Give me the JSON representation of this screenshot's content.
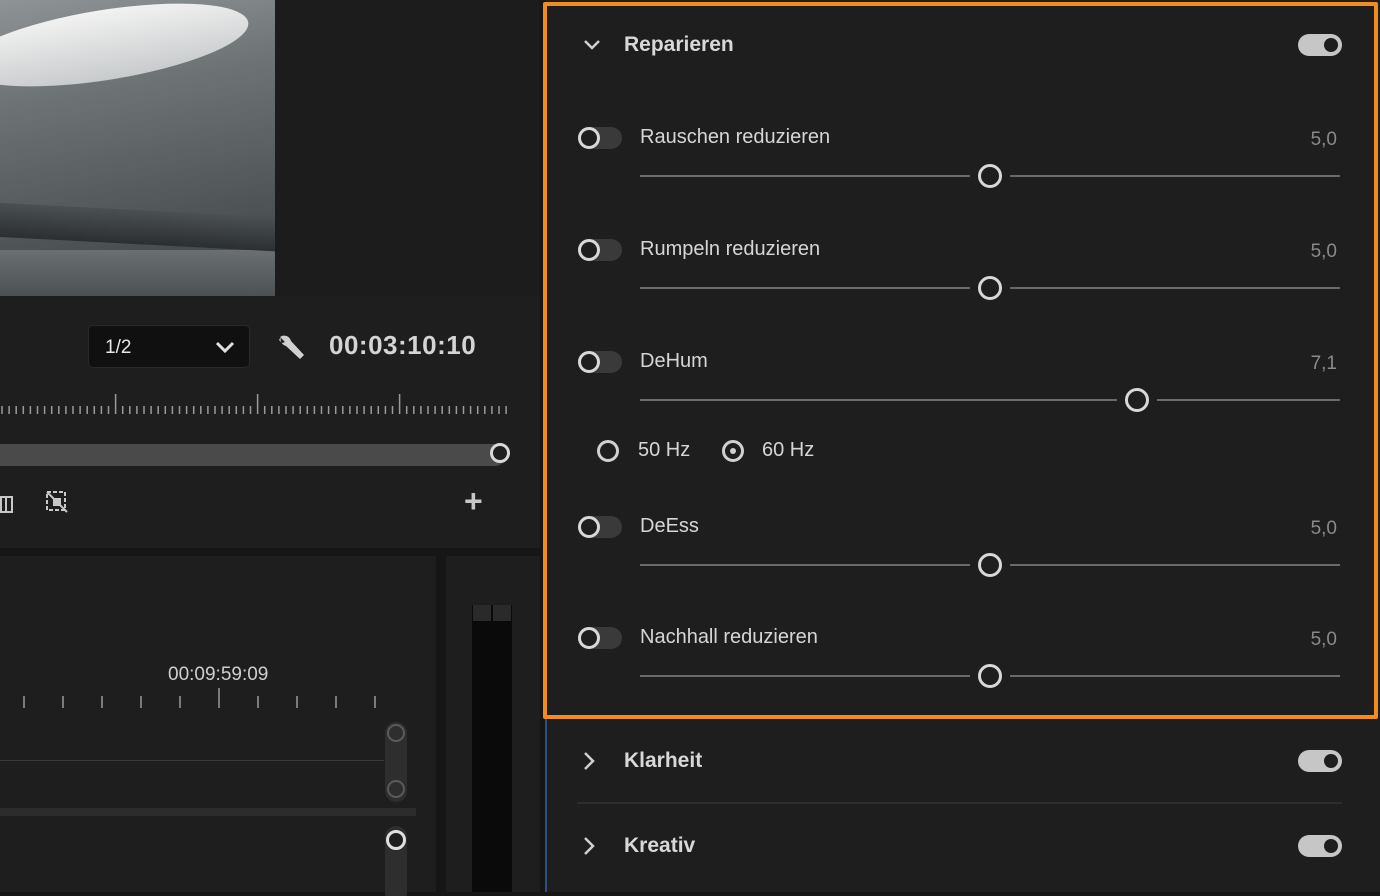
{
  "monitor": {
    "resolution_value": "1/2",
    "timecode": "00:03:10:10",
    "icons": [
      "chevron-down-icon",
      "wrench-icon",
      "export-frame-icon",
      "plus-icon"
    ]
  },
  "timeline": {
    "timecode": "00:09:59:09"
  },
  "essential_sound": {
    "repair_section": {
      "title": "Reparieren",
      "enabled": true,
      "params": [
        {
          "label": "Rauschen reduzieren",
          "value_text": "5,0",
          "value": 5.0,
          "enabled": false
        },
        {
          "label": "Rumpeln reduzieren",
          "value_text": "5,0",
          "value": 5.0,
          "enabled": false
        },
        {
          "label": "DeHum",
          "value_text": "7,1",
          "value": 7.1,
          "enabled": false
        },
        {
          "label": "DeEss",
          "value_text": "5,0",
          "value": 5.0,
          "enabled": false
        },
        {
          "label": "Nachhall reduzieren",
          "value_text": "5,0",
          "value": 5.0,
          "enabled": false
        }
      ],
      "hum_frequency": {
        "options": [
          "50 Hz",
          "60 Hz"
        ],
        "selected": "60 Hz"
      }
    },
    "clarity_section": {
      "title": "Klarheit",
      "enabled": true
    },
    "creative_section": {
      "title": "Kreativ",
      "enabled": true
    }
  },
  "colors": {
    "highlight_border": "#f28c1e",
    "panel_bg": "#1e1e1e"
  }
}
